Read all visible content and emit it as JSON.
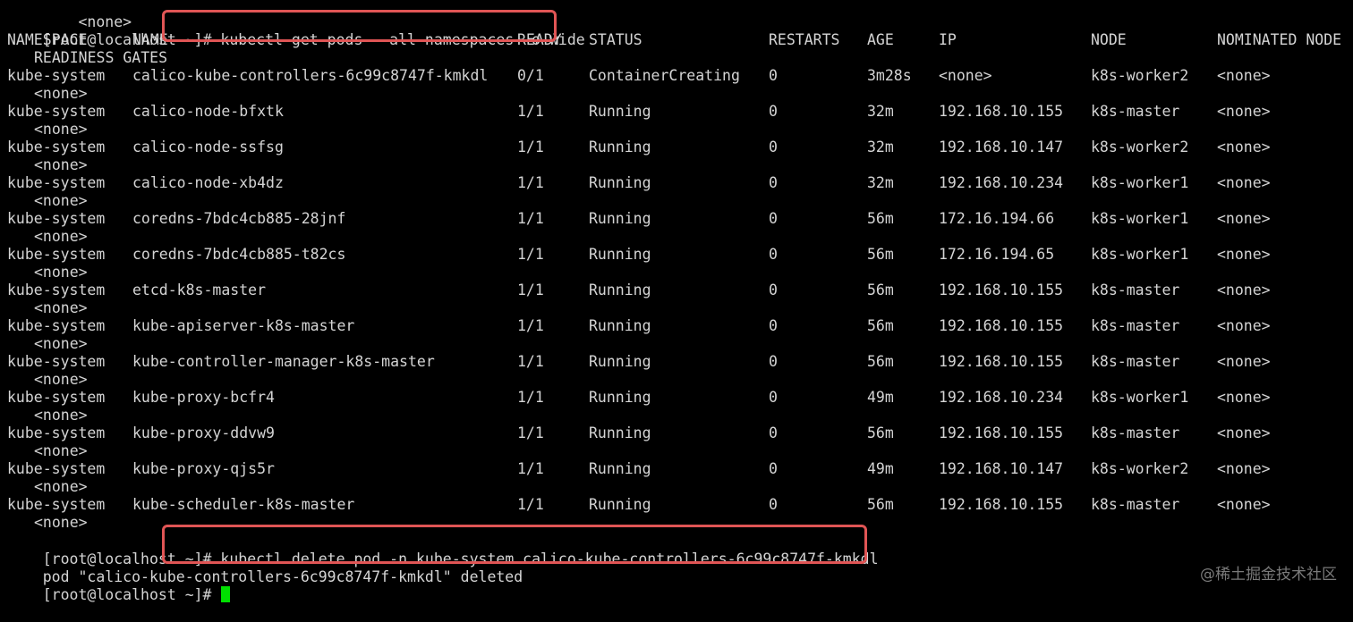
{
  "colors": {
    "background": "#000000",
    "text": "#d4d4d4",
    "cursor": "#00e000",
    "highlight": "#e05555",
    "watermark": "#7a7a7a"
  },
  "top_fragment": "    <none>",
  "command1": {
    "prompt": "[root@localhost ~]",
    "text": "# kubectl get pods --all-namespaces -o wide"
  },
  "header": {
    "namespace": "NAMESPACE",
    "name": "NAME",
    "ready": "READY",
    "status": "STATUS",
    "restarts": "RESTARTS",
    "age": "AGE",
    "ip": "IP",
    "node": "NODE",
    "nominated_node": "NOMINATED NODE",
    "readiness_gates": "READINESS GATES"
  },
  "pods": [
    {
      "namespace": "kube-system",
      "name": "calico-kube-controllers-6c99c8747f-kmkdl",
      "ready": "0/1",
      "status": "ContainerCreating",
      "restarts": "0",
      "age": "3m28s",
      "ip": "<none>",
      "node": "k8s-worker2",
      "nominated": "<none>",
      "gates": "<none>"
    },
    {
      "namespace": "kube-system",
      "name": "calico-node-bfxtk",
      "ready": "1/1",
      "status": "Running",
      "restarts": "0",
      "age": "32m",
      "ip": "192.168.10.155",
      "node": "k8s-master",
      "nominated": "<none>",
      "gates": "<none>"
    },
    {
      "namespace": "kube-system",
      "name": "calico-node-ssfsg",
      "ready": "1/1",
      "status": "Running",
      "restarts": "0",
      "age": "32m",
      "ip": "192.168.10.147",
      "node": "k8s-worker2",
      "nominated": "<none>",
      "gates": "<none>"
    },
    {
      "namespace": "kube-system",
      "name": "calico-node-xb4dz",
      "ready": "1/1",
      "status": "Running",
      "restarts": "0",
      "age": "32m",
      "ip": "192.168.10.234",
      "node": "k8s-worker1",
      "nominated": "<none>",
      "gates": "<none>"
    },
    {
      "namespace": "kube-system",
      "name": "coredns-7bdc4cb885-28jnf",
      "ready": "1/1",
      "status": "Running",
      "restarts": "0",
      "age": "56m",
      "ip": "172.16.194.66",
      "node": "k8s-worker1",
      "nominated": "<none>",
      "gates": "<none>"
    },
    {
      "namespace": "kube-system",
      "name": "coredns-7bdc4cb885-t82cs",
      "ready": "1/1",
      "status": "Running",
      "restarts": "0",
      "age": "56m",
      "ip": "172.16.194.65",
      "node": "k8s-worker1",
      "nominated": "<none>",
      "gates": "<none>"
    },
    {
      "namespace": "kube-system",
      "name": "etcd-k8s-master",
      "ready": "1/1",
      "status": "Running",
      "restarts": "0",
      "age": "56m",
      "ip": "192.168.10.155",
      "node": "k8s-master",
      "nominated": "<none>",
      "gates": "<none>"
    },
    {
      "namespace": "kube-system",
      "name": "kube-apiserver-k8s-master",
      "ready": "1/1",
      "status": "Running",
      "restarts": "0",
      "age": "56m",
      "ip": "192.168.10.155",
      "node": "k8s-master",
      "nominated": "<none>",
      "gates": "<none>"
    },
    {
      "namespace": "kube-system",
      "name": "kube-controller-manager-k8s-master",
      "ready": "1/1",
      "status": "Running",
      "restarts": "0",
      "age": "56m",
      "ip": "192.168.10.155",
      "node": "k8s-master",
      "nominated": "<none>",
      "gates": "<none>"
    },
    {
      "namespace": "kube-system",
      "name": "kube-proxy-bcfr4",
      "ready": "1/1",
      "status": "Running",
      "restarts": "0",
      "age": "49m",
      "ip": "192.168.10.234",
      "node": "k8s-worker1",
      "nominated": "<none>",
      "gates": "<none>"
    },
    {
      "namespace": "kube-system",
      "name": "kube-proxy-ddvw9",
      "ready": "1/1",
      "status": "Running",
      "restarts": "0",
      "age": "56m",
      "ip": "192.168.10.155",
      "node": "k8s-master",
      "nominated": "<none>",
      "gates": "<none>"
    },
    {
      "namespace": "kube-system",
      "name": "kube-proxy-qjs5r",
      "ready": "1/1",
      "status": "Running",
      "restarts": "0",
      "age": "49m",
      "ip": "192.168.10.147",
      "node": "k8s-worker2",
      "nominated": "<none>",
      "gates": "<none>"
    },
    {
      "namespace": "kube-system",
      "name": "kube-scheduler-k8s-master",
      "ready": "1/1",
      "status": "Running",
      "restarts": "0",
      "age": "56m",
      "ip": "192.168.10.155",
      "node": "k8s-master",
      "nominated": "<none>",
      "gates": "<none>"
    }
  ],
  "command2": {
    "prompt": "[root@localhost ~]#",
    "text": " kubectl delete pod -n kube-system calico-kube-controllers-6c99c8747f-kmkdl"
  },
  "delete_output": "pod \"calico-kube-controllers-6c99c8747f-kmkdl\" deleted",
  "final_prompt": "[root@localhost ~]# ",
  "watermark": "@稀土掘金技术社区"
}
